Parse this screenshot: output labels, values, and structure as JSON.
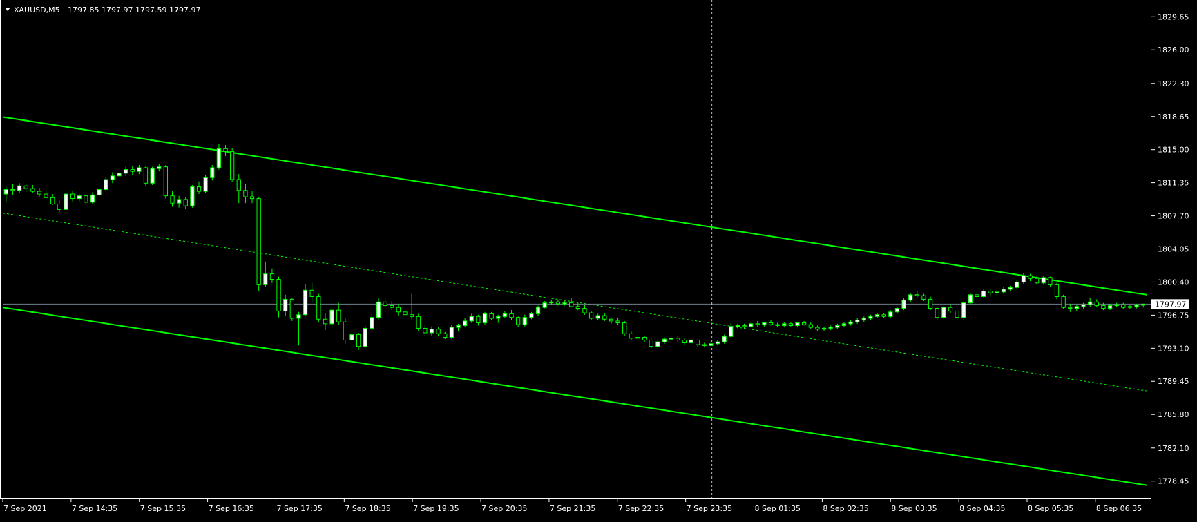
{
  "header": {
    "symbol": "XAUUSD,M5",
    "ohlc": "1797.85 1797.97 1797.59 1797.97"
  },
  "colors": {
    "background": "#000000",
    "foreground": "#ffffff",
    "bull_candle": "#ffffff",
    "bear_candle": "#000000",
    "candle_outline": "#00ff00",
    "channel": "#00ff00",
    "bid_line": "#708090",
    "crosshair": "#c0c0c0"
  },
  "chart_data": {
    "type": "candlestick",
    "title": "XAUUSD,M5",
    "xlabel": "",
    "ylabel": "",
    "ylim": [
      1776.6,
      1831.5
    ],
    "y_ticks": [
      "1829.65",
      "1826.00",
      "1822.30",
      "1818.65",
      "1815.00",
      "1811.35",
      "1807.70",
      "1804.05",
      "1800.40",
      "1796.75",
      "1793.10",
      "1789.45",
      "1785.80",
      "1782.10",
      "1778.45"
    ],
    "x_ticks": [
      "7 Sep 2021",
      "7 Sep 14:35",
      "7 Sep 15:35",
      "7 Sep 16:35",
      "7 Sep 17:35",
      "7 Sep 18:35",
      "7 Sep 19:35",
      "7 Sep 20:35",
      "7 Sep 21:35",
      "7 Sep 22:35",
      "7 Sep 23:35",
      "8 Sep 01:35",
      "8 Sep 02:35",
      "8 Sep 03:35",
      "8 Sep 04:35",
      "8 Sep 05:35",
      "8 Sep 06:35"
    ],
    "current_price": "1797.97",
    "channel": {
      "upper": {
        "start": 1818.6,
        "end": 1799.0
      },
      "middle": {
        "start": 1808.0,
        "end": 1788.4
      },
      "lower": {
        "start": 1797.6,
        "end": 1778.0
      }
    },
    "crosshair_x_label": "7 Sep 23:35",
    "candles": [
      [
        1810.1,
        1810.9,
        1809.3,
        1810.6
      ],
      [
        1810.6,
        1811.2,
        1810.0,
        1810.5
      ],
      [
        1810.5,
        1811.3,
        1810.2,
        1811.0
      ],
      [
        1811.0,
        1811.2,
        1810.3,
        1810.7
      ],
      [
        1810.7,
        1811.1,
        1810.2,
        1810.4
      ],
      [
        1810.4,
        1810.8,
        1809.8,
        1810.1
      ],
      [
        1810.1,
        1810.6,
        1809.6,
        1809.7
      ],
      [
        1809.7,
        1810.1,
        1808.9,
        1809.0
      ],
      [
        1809.0,
        1809.4,
        1808.1,
        1808.4
      ],
      [
        1808.4,
        1810.3,
        1808.2,
        1810.1
      ],
      [
        1810.1,
        1810.4,
        1809.3,
        1809.6
      ],
      [
        1809.6,
        1810.1,
        1809.2,
        1809.9
      ],
      [
        1809.9,
        1810.0,
        1808.9,
        1809.2
      ],
      [
        1809.2,
        1810.3,
        1809.0,
        1810.0
      ],
      [
        1810.0,
        1810.8,
        1809.7,
        1810.6
      ],
      [
        1810.6,
        1812.0,
        1810.4,
        1811.7
      ],
      [
        1811.7,
        1812.5,
        1811.3,
        1812.1
      ],
      [
        1812.1,
        1812.7,
        1811.8,
        1812.4
      ],
      [
        1812.4,
        1813.1,
        1812.1,
        1812.8
      ],
      [
        1812.8,
        1813.2,
        1812.2,
        1812.6
      ],
      [
        1812.6,
        1813.3,
        1812.3,
        1813.0
      ],
      [
        1813.0,
        1813.2,
        1811.0,
        1811.3
      ],
      [
        1811.3,
        1813.1,
        1811.1,
        1812.9
      ],
      [
        1812.9,
        1813.4,
        1812.6,
        1813.1
      ],
      [
        1813.1,
        1813.3,
        1809.6,
        1809.9
      ],
      [
        1809.9,
        1810.4,
        1808.7,
        1809.1
      ],
      [
        1809.1,
        1809.9,
        1808.6,
        1809.5
      ],
      [
        1809.5,
        1809.8,
        1808.5,
        1808.8
      ],
      [
        1808.8,
        1811.1,
        1808.6,
        1810.9
      ],
      [
        1810.9,
        1811.5,
        1810.1,
        1810.4
      ],
      [
        1810.4,
        1812.2,
        1810.2,
        1811.9
      ],
      [
        1811.9,
        1813.3,
        1811.6,
        1813.0
      ],
      [
        1813.0,
        1815.6,
        1812.8,
        1815.1
      ],
      [
        1815.1,
        1815.5,
        1814.3,
        1814.8
      ],
      [
        1814.8,
        1815.2,
        1811.4,
        1811.7
      ],
      [
        1811.7,
        1812.3,
        1809.1,
        1810.5
      ],
      [
        1810.5,
        1811.2,
        1809.1,
        1809.8
      ],
      [
        1809.8,
        1810.4,
        1809.1,
        1809.6
      ],
      [
        1809.6,
        1809.8,
        1799.4,
        1800.1
      ],
      [
        1800.1,
        1802.6,
        1799.9,
        1801.3
      ],
      [
        1801.3,
        1801.9,
        1800.3,
        1800.7
      ],
      [
        1800.7,
        1801.0,
        1796.5,
        1797.2
      ],
      [
        1797.2,
        1799.0,
        1796.7,
        1798.5
      ],
      [
        1798.5,
        1798.6,
        1796.1,
        1796.4
      ],
      [
        1796.4,
        1797.1,
        1793.4,
        1796.8
      ],
      [
        1796.8,
        1800.2,
        1796.6,
        1799.5
      ],
      [
        1799.5,
        1800.3,
        1798.2,
        1798.8
      ],
      [
        1798.8,
        1799.1,
        1796.0,
        1796.3
      ],
      [
        1796.3,
        1797.0,
        1795.1,
        1795.8
      ],
      [
        1795.8,
        1797.6,
        1795.5,
        1797.3
      ],
      [
        1797.3,
        1798.1,
        1795.7,
        1796.0
      ],
      [
        1796.0,
        1796.4,
        1793.6,
        1794.0
      ],
      [
        1794.0,
        1795.0,
        1792.7,
        1794.6
      ],
      [
        1794.6,
        1794.8,
        1792.9,
        1793.3
      ],
      [
        1793.3,
        1795.6,
        1793.1,
        1795.3
      ],
      [
        1795.3,
        1796.9,
        1795.0,
        1796.5
      ],
      [
        1796.5,
        1798.6,
        1796.3,
        1798.2
      ],
      [
        1798.2,
        1798.6,
        1797.5,
        1797.8
      ],
      [
        1797.8,
        1798.3,
        1797.3,
        1797.6
      ],
      [
        1797.6,
        1798.0,
        1796.7,
        1797.1
      ],
      [
        1797.1,
        1797.5,
        1796.4,
        1796.8
      ],
      [
        1796.8,
        1799.1,
        1796.3,
        1796.6
      ],
      [
        1796.6,
        1796.9,
        1795.0,
        1795.3
      ],
      [
        1795.3,
        1795.7,
        1794.5,
        1794.8
      ],
      [
        1794.8,
        1795.5,
        1794.5,
        1795.2
      ],
      [
        1795.2,
        1795.4,
        1794.4,
        1794.7
      ],
      [
        1794.7,
        1794.9,
        1794.1,
        1794.3
      ],
      [
        1794.3,
        1795.7,
        1794.1,
        1795.4
      ],
      [
        1795.4,
        1795.8,
        1795.0,
        1795.6
      ],
      [
        1795.6,
        1796.4,
        1795.4,
        1796.1
      ],
      [
        1796.1,
        1796.9,
        1795.9,
        1796.6
      ],
      [
        1796.6,
        1796.8,
        1795.6,
        1795.9
      ],
      [
        1795.9,
        1797.1,
        1795.7,
        1796.9
      ],
      [
        1796.9,
        1797.1,
        1796.2,
        1796.4
      ],
      [
        1796.4,
        1796.8,
        1795.9,
        1796.6
      ],
      [
        1796.6,
        1797.2,
        1796.4,
        1796.9
      ],
      [
        1796.9,
        1797.3,
        1796.2,
        1796.5
      ],
      [
        1796.5,
        1796.6,
        1795.4,
        1795.7
      ],
      [
        1795.7,
        1796.8,
        1795.5,
        1796.5
      ],
      [
        1796.5,
        1797.1,
        1796.3,
        1796.9
      ],
      [
        1796.9,
        1797.8,
        1796.7,
        1797.6
      ],
      [
        1797.6,
        1798.3,
        1797.5,
        1798.1
      ],
      [
        1798.1,
        1798.4,
        1797.9,
        1798.2
      ],
      [
        1798.2,
        1798.4,
        1797.8,
        1798.0
      ],
      [
        1798.0,
        1798.3,
        1797.8,
        1798.1
      ],
      [
        1798.1,
        1798.6,
        1797.6,
        1797.7
      ],
      [
        1797.7,
        1798.1,
        1797.3,
        1797.5
      ],
      [
        1797.5,
        1797.9,
        1796.8,
        1797.0
      ],
      [
        1797.0,
        1797.2,
        1796.2,
        1796.4
      ],
      [
        1796.4,
        1796.9,
        1796.2,
        1796.7
      ],
      [
        1796.7,
        1797.0,
        1796.1,
        1796.3
      ],
      [
        1796.3,
        1796.5,
        1795.8,
        1796.1
      ],
      [
        1796.1,
        1796.4,
        1795.7,
        1795.9
      ],
      [
        1795.9,
        1796.1,
        1794.5,
        1794.7
      ],
      [
        1794.7,
        1795.0,
        1794.0,
        1794.2
      ],
      [
        1794.2,
        1794.6,
        1794.0,
        1794.3
      ],
      [
        1794.3,
        1794.5,
        1793.8,
        1794.0
      ],
      [
        1794.0,
        1794.2,
        1793.1,
        1793.3
      ],
      [
        1793.3,
        1794.1,
        1793.0,
        1793.8
      ],
      [
        1793.8,
        1794.3,
        1793.6,
        1794.1
      ],
      [
        1794.1,
        1794.5,
        1793.9,
        1794.2
      ],
      [
        1794.2,
        1794.5,
        1793.8,
        1794.0
      ],
      [
        1794.0,
        1794.2,
        1793.5,
        1793.7
      ],
      [
        1793.7,
        1794.2,
        1793.5,
        1794.0
      ],
      [
        1794.0,
        1794.1,
        1793.3,
        1793.5
      ],
      [
        1793.5,
        1793.7,
        1793.2,
        1793.4
      ],
      [
        1793.4,
        1793.8,
        1793.2,
        1793.6
      ],
      [
        1793.6,
        1794.0,
        1793.4,
        1793.8
      ],
      [
        1793.8,
        1794.6,
        1793.6,
        1794.4
      ],
      [
        1794.4,
        1795.9,
        1794.3,
        1795.5
      ],
      [
        1795.5,
        1795.8,
        1795.3,
        1795.6
      ],
      [
        1795.6,
        1795.8,
        1795.3,
        1795.5
      ],
      [
        1795.5,
        1796.0,
        1795.4,
        1795.8
      ],
      [
        1795.8,
        1796.1,
        1795.5,
        1795.7
      ],
      [
        1795.7,
        1796.0,
        1795.5,
        1795.9
      ],
      [
        1795.9,
        1796.2,
        1795.6,
        1795.7
      ],
      [
        1795.7,
        1795.9,
        1795.4,
        1795.6
      ],
      [
        1795.6,
        1796.0,
        1795.4,
        1795.8
      ],
      [
        1795.8,
        1796.0,
        1795.5,
        1795.6
      ],
      [
        1795.6,
        1796.0,
        1795.5,
        1795.9
      ],
      [
        1795.9,
        1796.1,
        1795.6,
        1795.7
      ],
      [
        1795.7,
        1796.0,
        1795.2,
        1795.4
      ],
      [
        1795.4,
        1795.6,
        1795.0,
        1795.2
      ],
      [
        1795.2,
        1795.5,
        1795.0,
        1795.3
      ],
      [
        1795.3,
        1795.6,
        1795.1,
        1795.4
      ],
      [
        1795.4,
        1795.8,
        1795.2,
        1795.6
      ],
      [
        1795.6,
        1796.0,
        1795.4,
        1795.8
      ],
      [
        1795.8,
        1796.2,
        1795.6,
        1796.0
      ],
      [
        1796.0,
        1796.4,
        1795.8,
        1796.2
      ],
      [
        1796.2,
        1796.6,
        1796.0,
        1796.4
      ],
      [
        1796.4,
        1796.8,
        1796.2,
        1796.6
      ],
      [
        1796.6,
        1797.0,
        1796.4,
        1796.8
      ],
      [
        1796.8,
        1797.0,
        1796.4,
        1796.6
      ],
      [
        1796.6,
        1797.3,
        1796.4,
        1797.1
      ],
      [
        1797.1,
        1797.7,
        1796.9,
        1797.5
      ],
      [
        1797.5,
        1798.6,
        1797.3,
        1798.4
      ],
      [
        1798.4,
        1799.2,
        1798.2,
        1799.0
      ],
      [
        1799.0,
        1799.4,
        1798.7,
        1798.9
      ],
      [
        1798.9,
        1799.1,
        1798.3,
        1798.5
      ],
      [
        1798.5,
        1798.8,
        1797.3,
        1797.5
      ],
      [
        1797.5,
        1797.7,
        1796.2,
        1796.5
      ],
      [
        1796.5,
        1797.8,
        1796.3,
        1797.6
      ],
      [
        1797.6,
        1798.0,
        1797.0,
        1797.2
      ],
      [
        1797.2,
        1797.4,
        1796.2,
        1796.5
      ],
      [
        1796.5,
        1798.3,
        1796.3,
        1798.1
      ],
      [
        1798.1,
        1799.2,
        1797.9,
        1799.0
      ],
      [
        1799.0,
        1799.5,
        1798.6,
        1798.8
      ],
      [
        1798.8,
        1799.6,
        1798.6,
        1799.4
      ],
      [
        1799.4,
        1799.6,
        1798.9,
        1799.2
      ],
      [
        1799.2,
        1799.6,
        1798.8,
        1799.3
      ],
      [
        1799.3,
        1799.9,
        1799.1,
        1799.6
      ],
      [
        1799.6,
        1800.0,
        1799.4,
        1799.8
      ],
      [
        1799.8,
        1800.6,
        1799.6,
        1800.4
      ],
      [
        1800.4,
        1801.4,
        1800.2,
        1801.1
      ],
      [
        1801.1,
        1801.3,
        1800.5,
        1800.8
      ],
      [
        1800.8,
        1801.1,
        1800.1,
        1800.3
      ],
      [
        1800.3,
        1801.1,
        1800.1,
        1800.9
      ],
      [
        1800.9,
        1801.0,
        1799.9,
        1800.1
      ],
      [
        1800.1,
        1800.3,
        1798.5,
        1798.8
      ],
      [
        1798.8,
        1799.0,
        1797.4,
        1797.6
      ],
      [
        1797.6,
        1798.0,
        1797.1,
        1797.5
      ],
      [
        1797.5,
        1797.9,
        1797.2,
        1797.7
      ],
      [
        1797.7,
        1798.1,
        1797.4,
        1797.9
      ],
      [
        1797.9,
        1798.7,
        1797.7,
        1798.2
      ],
      [
        1798.2,
        1798.5,
        1797.6,
        1797.8
      ],
      [
        1797.8,
        1798.1,
        1797.3,
        1797.5
      ],
      [
        1797.5,
        1798.0,
        1797.3,
        1797.8
      ],
      [
        1797.8,
        1798.1,
        1797.6,
        1797.9
      ],
      [
        1797.9,
        1798.1,
        1797.4,
        1797.6
      ],
      [
        1797.6,
        1797.9,
        1797.4,
        1797.7
      ],
      [
        1797.7,
        1798.0,
        1797.5,
        1797.85
      ],
      [
        1797.85,
        1797.97,
        1797.59,
        1797.97
      ]
    ]
  }
}
